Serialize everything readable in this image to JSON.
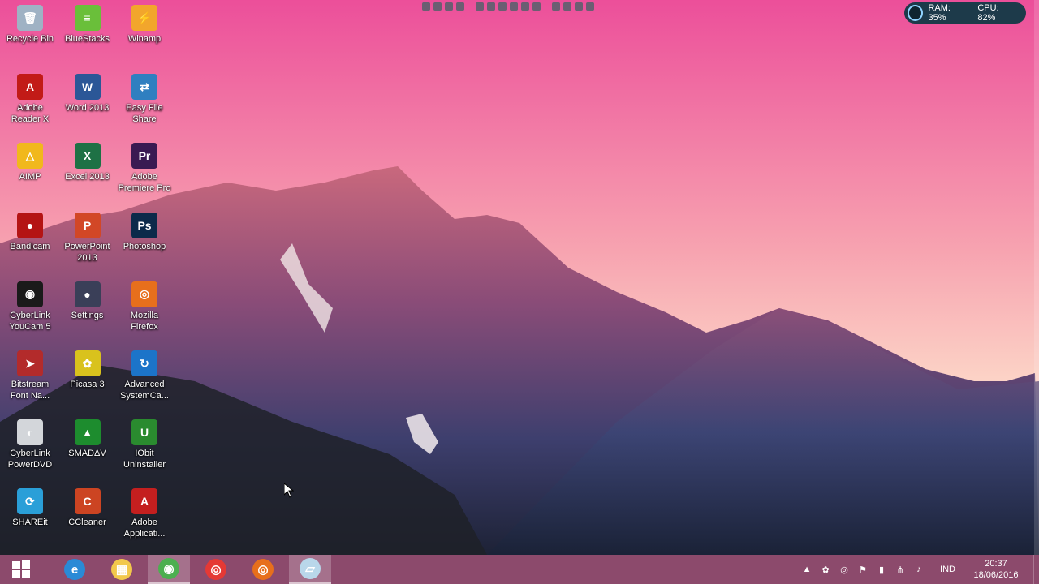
{
  "desktop": {
    "icons": [
      {
        "label": "Recycle Bin",
        "icon": "recycle-bin-icon",
        "color": "#9fb2c4",
        "glyph": "🗑"
      },
      {
        "label": "BlueStacks",
        "icon": "bluestacks-icon",
        "color": "#6abf3a",
        "glyph": "≡"
      },
      {
        "label": "Winamp",
        "icon": "winamp-icon",
        "color": "#f2a62c",
        "glyph": "⚡"
      },
      {
        "label": "Adobe\nReader X",
        "icon": "adobe-reader-icon",
        "color": "#c21b17",
        "glyph": "A"
      },
      {
        "label": "Word 2013",
        "icon": "word-icon",
        "color": "#2b5797",
        "glyph": "W"
      },
      {
        "label": "Easy File\nShare",
        "icon": "easy-file-share-icon",
        "color": "#2f7fc0",
        "glyph": "⇄"
      },
      {
        "label": "AIMP",
        "icon": "aimp-icon",
        "color": "#f1b81c",
        "glyph": "△"
      },
      {
        "label": "Excel 2013",
        "icon": "excel-icon",
        "color": "#1e7145",
        "glyph": "X"
      },
      {
        "label": "Adobe\nPremiere Pro",
        "icon": "premiere-icon",
        "color": "#3a1a52",
        "glyph": "Pr"
      },
      {
        "label": "Bandicam",
        "icon": "bandicam-icon",
        "color": "#b41414",
        "glyph": "●"
      },
      {
        "label": "PowerPoint\n2013",
        "icon": "powerpoint-icon",
        "color": "#d24726",
        "glyph": "P"
      },
      {
        "label": "Photoshop",
        "icon": "photoshop-icon",
        "color": "#0c2a4a",
        "glyph": "Ps"
      },
      {
        "label": "CyberLink\nYouCam 5",
        "icon": "youcam-icon",
        "color": "#1a1a1a",
        "glyph": "◉"
      },
      {
        "label": "Settings",
        "icon": "settings-icon",
        "color": "#3a3f58",
        "glyph": "●"
      },
      {
        "label": "Mozilla\nFirefox",
        "icon": "firefox-icon",
        "color": "#e76f1c",
        "glyph": "◎"
      },
      {
        "label": "Bitstream\nFont Na...",
        "icon": "bitstream-icon",
        "color": "#b32b2b",
        "glyph": "➤"
      },
      {
        "label": "Picasa 3",
        "icon": "picasa-icon",
        "color": "#d9c21d",
        "glyph": "✿"
      },
      {
        "label": "Advanced\nSystemCa...",
        "icon": "advanced-systemcare-icon",
        "color": "#1c74c9",
        "glyph": "↻"
      },
      {
        "label": "CyberLink\nPowerDVD",
        "icon": "powerdvd-icon",
        "color": "#d3d6da",
        "glyph": "◐"
      },
      {
        "label": "SMADΔV",
        "icon": "smadav-icon",
        "color": "#1d8c2e",
        "glyph": "▲"
      },
      {
        "label": "IObit\nUninstaller",
        "icon": "iobit-uninstaller-icon",
        "color": "#2a8b2f",
        "glyph": "U"
      },
      {
        "label": "SHAREit",
        "icon": "shareit-icon",
        "color": "#2a9fd8",
        "glyph": "⟳"
      },
      {
        "label": "CCleaner",
        "icon": "ccleaner-icon",
        "color": "#cc4422",
        "glyph": "C"
      },
      {
        "label": "Adobe\nApplicati...",
        "icon": "adobe-application-manager-icon",
        "color": "#c41f1f",
        "glyph": "A"
      }
    ]
  },
  "system_monitor": {
    "ram": "RAM: 35%",
    "cpu": "CPU: 82%"
  },
  "taskbar": {
    "pinned": [
      {
        "name": "internet-explorer-icon",
        "glyph": "e",
        "color": "#2a8ad6"
      },
      {
        "name": "file-explorer-icon",
        "glyph": "▦",
        "color": "#f2c84b"
      },
      {
        "name": "chrome-icon",
        "glyph": "◉",
        "color": "#4caf50"
      },
      {
        "name": "bandicam-taskbar-icon",
        "glyph": "◎",
        "color": "#e53935"
      },
      {
        "name": "firefox-taskbar-icon",
        "glyph": "◎",
        "color": "#e76f1c"
      },
      {
        "name": "notepad-icon",
        "glyph": "▱",
        "color": "#b9d7ea"
      }
    ],
    "tray": {
      "language": "IND",
      "time": "20:37",
      "date": "18/06/2016"
    }
  }
}
